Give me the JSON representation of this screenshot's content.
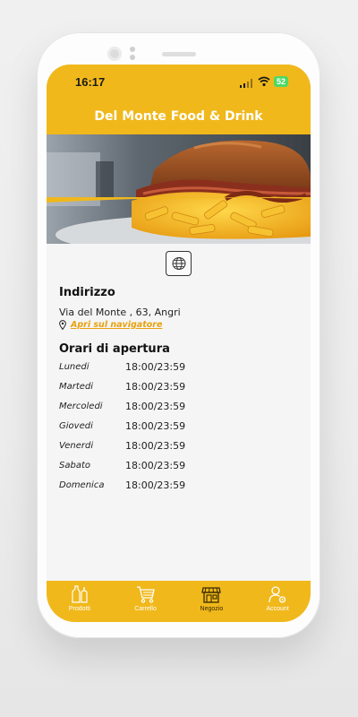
{
  "status_bar": {
    "time": "16:17",
    "battery": "52"
  },
  "app": {
    "title": "Del Monte Food & Drink"
  },
  "store": {
    "address_heading": "Indirizzo",
    "address": "Via del Monte , 63, Angri",
    "navigator_link": "Apri sul navigatore",
    "hours_heading": "Orari di apertura",
    "hours": [
      {
        "day": "Lunedi",
        "time": "18:00/23:59"
      },
      {
        "day": "Martedi",
        "time": "18:00/23:59"
      },
      {
        "day": "Mercoledi",
        "time": "18:00/23:59"
      },
      {
        "day": "Giovedi",
        "time": "18:00/23:59"
      },
      {
        "day": "Venerdi",
        "time": "18:00/23:59"
      },
      {
        "day": "Sabato",
        "time": "18:00/23:59"
      },
      {
        "day": "Domenica",
        "time": "18:00/23:59"
      }
    ]
  },
  "tabbar": {
    "items": [
      {
        "label": "Prodotti",
        "icon": "products-icon"
      },
      {
        "label": "Carrello",
        "icon": "cart-icon"
      },
      {
        "label": "Negozio",
        "icon": "store-icon",
        "active": true
      },
      {
        "label": "Account",
        "icon": "account-settings-icon"
      }
    ]
  },
  "colors": {
    "brand": "#f0b81b",
    "link": "#e8a10f",
    "background": "#f5f5f5"
  }
}
